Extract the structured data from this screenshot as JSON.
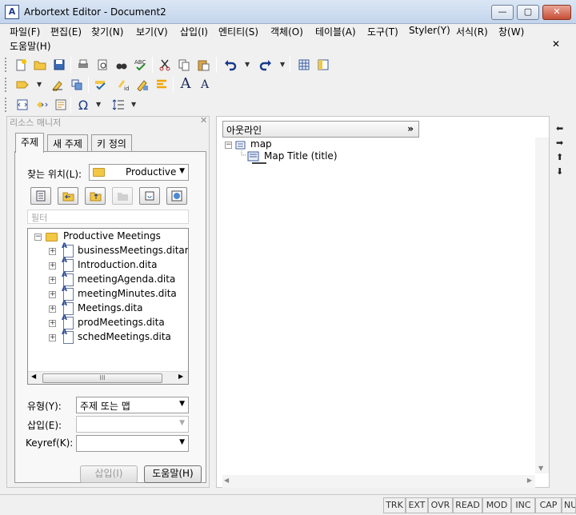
{
  "window": {
    "app_name": "Arbortext Editor -  Document2",
    "minimize": "—",
    "restore": "▢",
    "close": "✕"
  },
  "menu": {
    "items": [
      "파일(F)",
      "편집(E)",
      "찾기(N)",
      "보기(V)",
      "삽입(I)",
      "엔티티(S)",
      "객체(O)",
      "테이블(A)",
      "도구(T)",
      "Styler(Y)",
      "서식(R)",
      "창(W)",
      "도움말(H)"
    ],
    "close_doc": "✕"
  },
  "resource_manager": {
    "title": "리소스 매니저",
    "close": "✕",
    "tabs": [
      "주제",
      "새 주제",
      "키 정의"
    ],
    "look_in_label": "찾는 위치(L):",
    "look_in_value": "Productive",
    "filter_placeholder": "필터",
    "tree": {
      "root": "Productive Meetings",
      "files": [
        "businessMeetings.ditamap",
        "Introduction.dita",
        "meetingAgenda.dita",
        "meetingMinutes.dita",
        "Meetings.dita",
        "prodMeetings.dita",
        "schedMeetings.dita"
      ]
    },
    "scroll_thumb": "III",
    "type_label": "유형(Y):",
    "type_value": "주제 또는 맵",
    "insert_label": "삽입(E):",
    "insert_value": "",
    "keyref_label": "Keyref(K):",
    "keyref_value": "",
    "insert_button": "삽입(I)",
    "help_button": "도움말(H)"
  },
  "outline": {
    "tab_label": "아웃라인",
    "tab_chevron": "»",
    "root_node": "map",
    "child_node": "Map Title (title)"
  },
  "status": {
    "indicators": [
      "TRK",
      "EXT",
      "OVR",
      "READ",
      "MOD",
      "INC",
      "CAP",
      "NUM"
    ]
  },
  "colors": {
    "title_bar": "#c3d5ec",
    "folder": "#f2c744",
    "close_button": "#c64e36"
  }
}
